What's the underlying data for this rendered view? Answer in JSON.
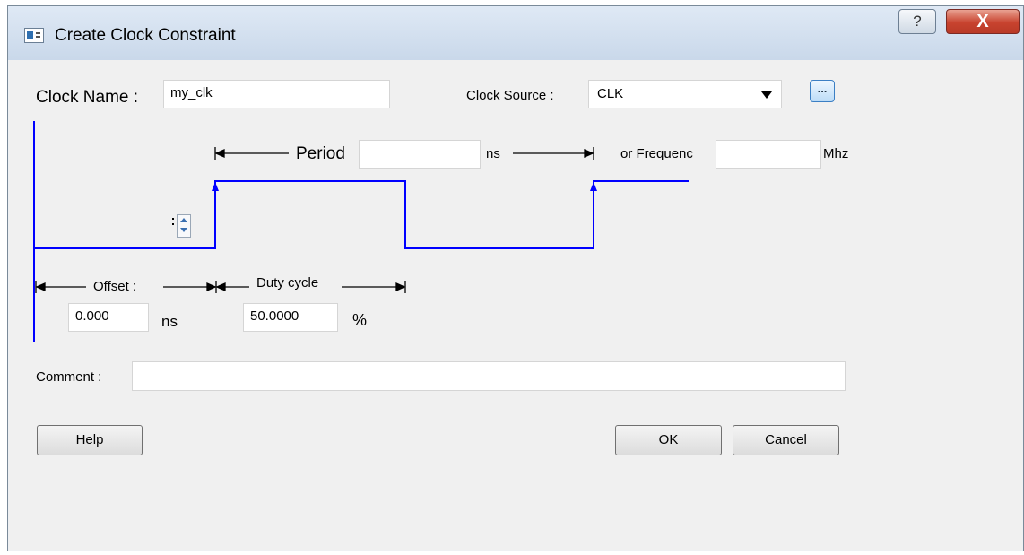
{
  "window": {
    "title": "Create Clock Constraint",
    "help_glyph": "?",
    "close_glyph": "X"
  },
  "form": {
    "clock_name_label": "Clock Name :",
    "clock_name_value": "my_clk",
    "clock_source_label": "Clock Source :",
    "clock_source_value": "CLK",
    "browse_label": "...",
    "period_label": "Period",
    "period_value": "",
    "period_unit": "ns",
    "frequency_label": "or Frequenc",
    "frequency_value": "",
    "frequency_unit": "Mhz",
    "offset_label": "Offset :",
    "offset_value": "0.000",
    "offset_unit": "ns",
    "duty_label": "Duty cycle",
    "duty_value": "50.0000",
    "duty_unit": "%",
    "comment_label": "Comment :",
    "comment_value": ""
  },
  "buttons": {
    "help": "Help",
    "ok": "OK",
    "cancel": "Cancel"
  },
  "colors": {
    "waveform": "#0000ff"
  }
}
